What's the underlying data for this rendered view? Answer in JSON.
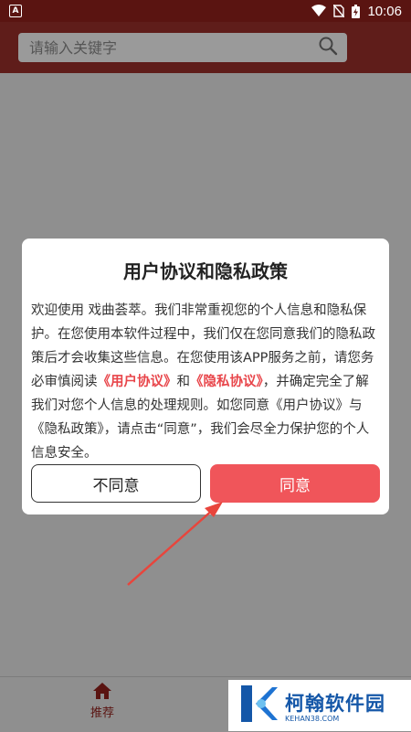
{
  "status_bar": {
    "app_badge": "A",
    "time": "10:06",
    "icons": [
      "wifi-icon",
      "no-sim-icon",
      "battery-charging-icon"
    ]
  },
  "header": {
    "search_placeholder": "请输入关键字",
    "search_icon": "search-icon"
  },
  "dialog": {
    "title": "用户协议和隐私政策",
    "text_1": "欢迎使用 戏曲荟萃。我们非常重视您的个人信息和隐私保护。在您使用本软件过程中，我们仅在您同意我们的隐私政策后才会收集这些信息。在您使用该APP服务之前，请您务必审慎阅读",
    "link_user_agreement": "《用户协议》",
    "text_2": "和",
    "link_privacy_policy": "《隐私协议》",
    "text_3": "，并确定完全了解我们对您个人信息的处理规则。如您同意《用户协议》与《隐私政策》，请点击“同意”，我们会尽全力保护您的个人信息安全。",
    "disagree_label": "不同意",
    "agree_label": "同意",
    "link_color": "#e8454a",
    "agree_color": "#f0555a"
  },
  "bottom_nav": {
    "items": [
      {
        "label": "推荐",
        "icon": "home-icon"
      }
    ]
  },
  "watermark": {
    "title": "柯翰软件园",
    "subtitle": "KEHAN38.COM"
  },
  "colors": {
    "status_bar": "#5a1411",
    "app_bar": "#5f1d1a",
    "overlay": "#8f8f8f",
    "annotation_arrow": "#e8453c"
  }
}
